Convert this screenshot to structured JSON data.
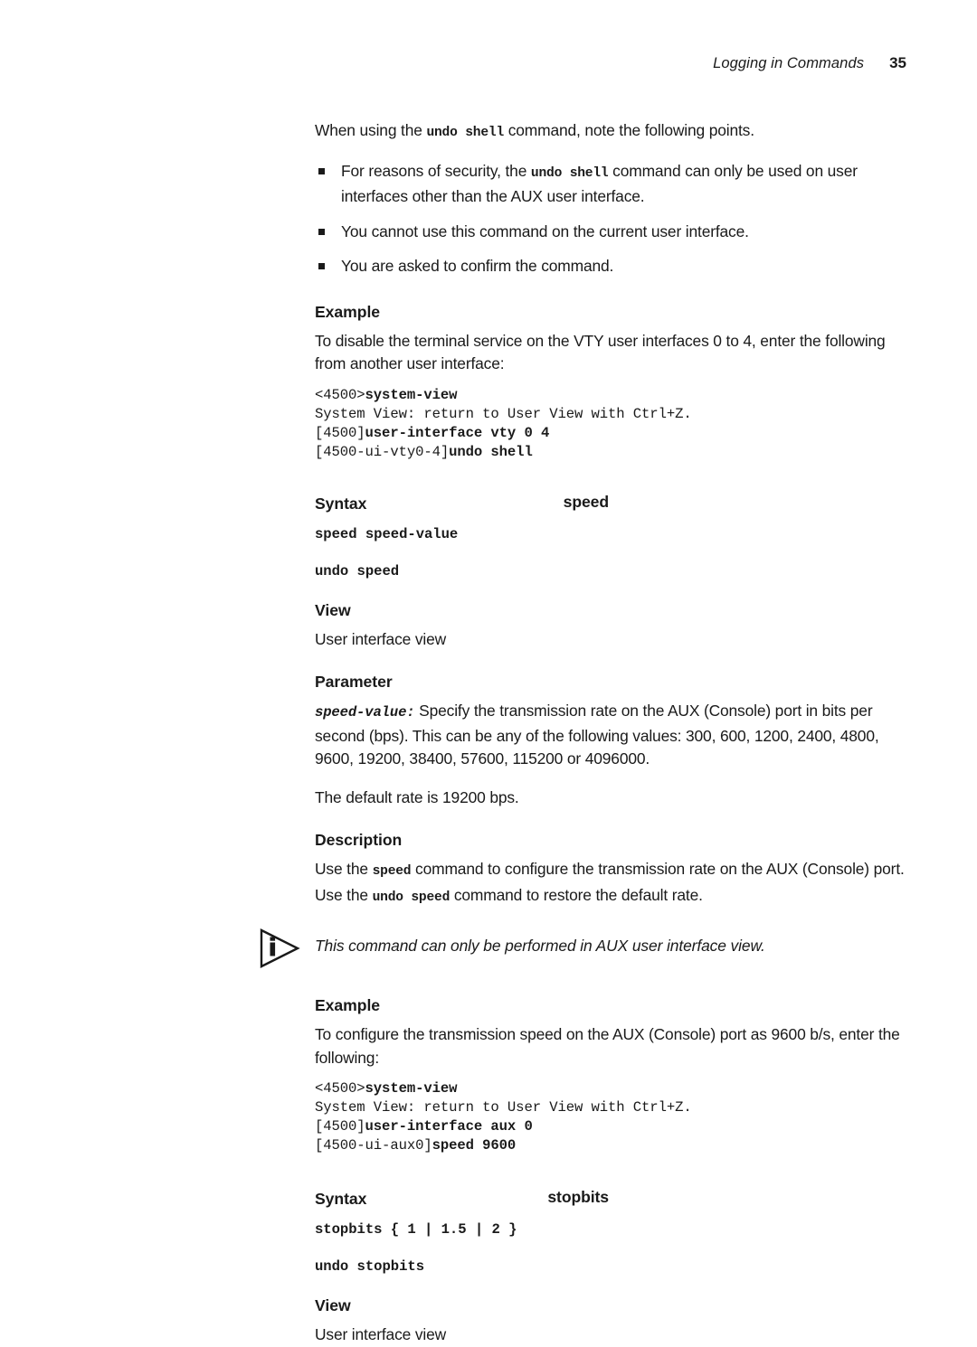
{
  "header": {
    "title": "Logging in Commands",
    "page_number": "35"
  },
  "intro": {
    "before": "When using the ",
    "code": "undo shell",
    "after": " command, note the following points."
  },
  "bullets": [
    {
      "before": "For reasons of security, the ",
      "code": "undo shell",
      "after": " command can only be used on user interfaces other than the AUX user interface."
    },
    {
      "before": "You cannot use this command on the current user interface.",
      "code": "",
      "after": ""
    },
    {
      "before": "You are asked to confirm the command.",
      "code": "",
      "after": ""
    }
  ],
  "shell_example": {
    "heading": "Example",
    "intro": "To disable the terminal service on the VTY user interfaces 0 to 4, enter the following from another user interface:",
    "lines": [
      {
        "prompt": "<4500>",
        "command": "system-view"
      },
      {
        "prompt": "System View: return to User View with Ctrl+Z.",
        "command": ""
      },
      {
        "prompt": "[4500]",
        "command": "user-interface vty 0 4"
      },
      {
        "prompt": "[4500-ui-vty0-4]",
        "command": "undo shell"
      }
    ]
  },
  "speed": {
    "margin_label": "speed",
    "syntax_heading": "Syntax",
    "syntax_lines": [
      "speed speed-value",
      "undo speed"
    ],
    "view_heading": "View",
    "view_text": "User interface view",
    "parameter_heading": "Parameter",
    "parameter_term": "speed-value:",
    "parameter_text": " Specify the transmission rate on the AUX (Console) port in bits per second (bps). This can be any of the following values: 300, 600, 1200, 2400, 4800, 9600, 19200, 38400, 57600, 115200 or 4096000.",
    "default_text": "The default rate is 19200 bps.",
    "description_heading": "Description",
    "description": {
      "seg1": "Use the ",
      "code1": "speed",
      "seg2": " command to configure the transmission rate on the AUX (Console) port. Use the ",
      "code2": "undo speed",
      "seg3": " command to restore the default rate."
    },
    "note": "This command can only be performed in AUX user interface view.",
    "example_heading": "Example",
    "example_intro": "To configure the transmission speed on the AUX (Console) port as 9600 b/s, enter the following:",
    "example_lines": [
      {
        "prompt": "<4500>",
        "command": "system-view"
      },
      {
        "prompt": "System View: return to User View with Ctrl+Z.",
        "command": ""
      },
      {
        "prompt": "[4500]",
        "command": "user-interface aux 0"
      },
      {
        "prompt": "[4500-ui-aux0]",
        "command": "speed 9600"
      }
    ]
  },
  "stopbits": {
    "margin_label": "stopbits",
    "syntax_heading": "Syntax",
    "syntax_lines": [
      "stopbits { 1 | 1.5 | 2 }",
      "undo stopbits"
    ],
    "view_heading": "View",
    "view_text": "User interface view"
  },
  "icons": {
    "note": "info-triangle-icon",
    "bullet": "square-bullet-icon"
  },
  "colors": {
    "text": "#1a1a1a",
    "background": "#ffffff"
  }
}
